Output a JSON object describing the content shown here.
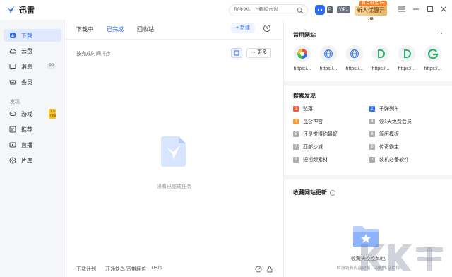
{
  "app": {
    "name": "迅雷"
  },
  "search": {
    "placeholder": "搜全网、下载和云盘"
  },
  "header": {
    "badge_p": "P",
    "badge_vip": "VIP1",
    "promo_tag": "首月低至0元",
    "promo_label": "新人优惠开通"
  },
  "sidebar": {
    "items": [
      {
        "label": "下载",
        "icon": "download-icon"
      },
      {
        "label": "云盘",
        "icon": "cloud-icon"
      },
      {
        "label": "消息",
        "icon": "message-icon",
        "count": "99"
      },
      {
        "label": "会员",
        "icon": "vip-icon"
      }
    ],
    "section": "发现",
    "discover": [
      {
        "label": "游戏",
        "icon": "game-icon",
        "tag": "1.5 new"
      },
      {
        "label": "推荐",
        "icon": "recommend-icon"
      },
      {
        "label": "直播",
        "icon": "live-icon"
      },
      {
        "label": "片库",
        "icon": "film-icon"
      }
    ]
  },
  "main": {
    "tabs": [
      "下载中",
      "已完成",
      "回收站"
    ],
    "new_button": "+ 新建",
    "sort_label": "按完成时间排序",
    "more_button": "··· 更多",
    "empty_text": "没有已完成任务",
    "footer": {
      "plan": "下载计划",
      "speed_tip": "开通快鸟 宽带翻倍",
      "rate": "0B/s"
    }
  },
  "right": {
    "sites_title": "常用网站",
    "sites": [
      {
        "label": "https:/...",
        "icon": "colorful-logo-icon"
      },
      {
        "label": "https:/...",
        "icon": "globe-icon"
      },
      {
        "label": "https:/...",
        "icon": "globe-icon"
      },
      {
        "label": "https:/...",
        "icon": "d-logo-icon"
      },
      {
        "label": "https:/...",
        "icon": "d-logo-icon"
      },
      {
        "label": "https:/...",
        "icon": "g-logo-icon"
      }
    ],
    "search_title": "搜索发现",
    "hot": [
      {
        "rank": "1",
        "label": "坠落"
      },
      {
        "rank": "2",
        "label": "子弹列车"
      },
      {
        "rank": "3",
        "label": "昆仑神宫"
      },
      {
        "rank": "4",
        "label": "领1天免费会员"
      },
      {
        "rank": "5",
        "label": "还是觉得你最好"
      },
      {
        "rank": "6",
        "label": "简历模板"
      },
      {
        "rank": "7",
        "label": "西部沙城"
      },
      {
        "rank": "8",
        "label": "传奇霸主"
      },
      {
        "rank": "9",
        "label": "短视频素材"
      },
      {
        "rank": "10",
        "label": "装机必备软件"
      }
    ],
    "fav_title": "收藏网站更新",
    "fav_empty": "收藏夹空空如也",
    "fav_sub": "检测到有内容更新，及时推送给你"
  },
  "colors": {
    "accent": "#2d6cf0",
    "rank1": "#f25a3d",
    "rank2": "#2d6cf0",
    "rank3": "#f59b2d"
  }
}
